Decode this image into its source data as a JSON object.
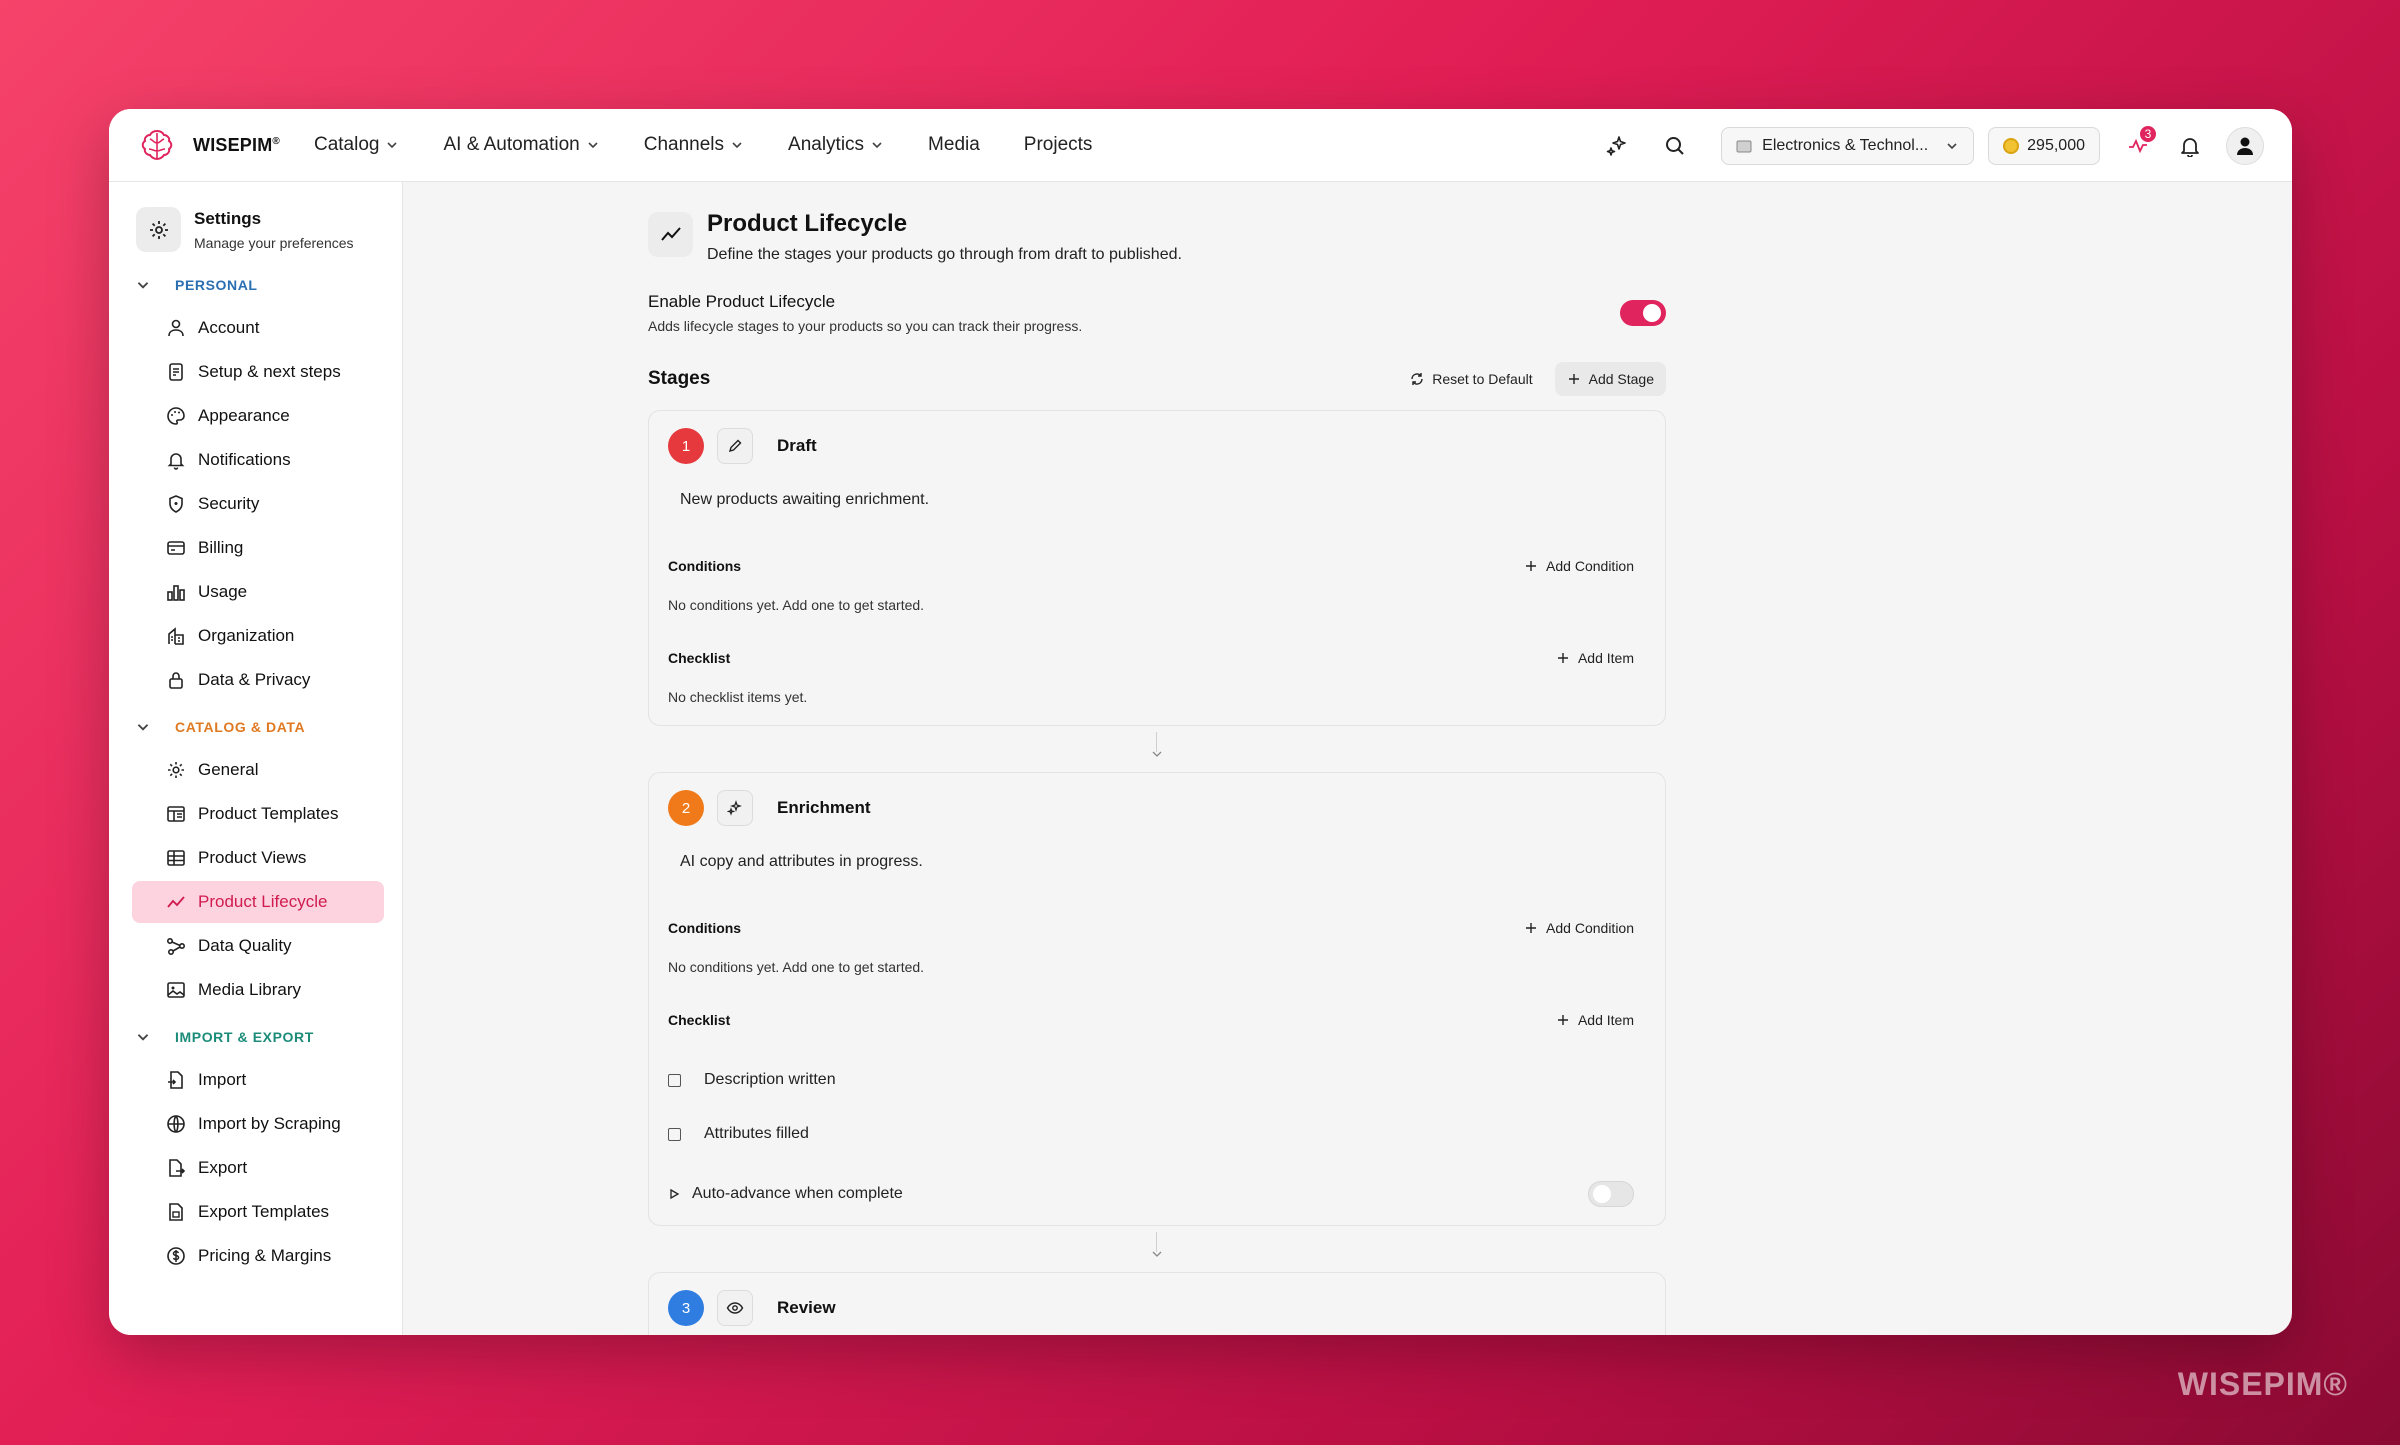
{
  "brand": {
    "name": "WISEPIM",
    "mark": "®",
    "watermark": "WISEPIM®"
  },
  "nav": [
    {
      "label": "Catalog",
      "dropdown": true
    },
    {
      "label": "AI & Automation",
      "dropdown": true
    },
    {
      "label": "Channels",
      "dropdown": true
    },
    {
      "label": "Analytics",
      "dropdown": true
    },
    {
      "label": "Media",
      "dropdown": false
    },
    {
      "label": "Projects",
      "dropdown": false
    }
  ],
  "topbar": {
    "workspace": "Electronics & Technol...",
    "credits": "295,000",
    "activity_badge": "3"
  },
  "sidebar": {
    "title": "Settings",
    "subtitle": "Manage your preferences",
    "sections": [
      {
        "label": "PERSONAL",
        "items": [
          "Account",
          "Setup & next steps",
          "Appearance",
          "Notifications",
          "Security",
          "Billing",
          "Usage",
          "Organization",
          "Data & Privacy"
        ]
      },
      {
        "label": "CATALOG & DATA",
        "items": [
          "General",
          "Product Templates",
          "Product Views",
          "Product Lifecycle",
          "Data Quality",
          "Media Library"
        ]
      },
      {
        "label": "IMPORT & EXPORT",
        "items": [
          "Import",
          "Import by Scraping",
          "Export",
          "Export Templates",
          "Pricing & Margins"
        ]
      }
    ],
    "active": "Product Lifecycle"
  },
  "page": {
    "title": "Product Lifecycle",
    "subtitle": "Define the stages your products go through from draft to published.",
    "enable_title": "Enable Product Lifecycle",
    "enable_sub": "Adds lifecycle stages to your products so you can track their progress.",
    "enable_on": true,
    "stages_title": "Stages",
    "reset_label": "Reset to Default",
    "add_stage_label": "Add Stage"
  },
  "stages": [
    {
      "num": "1",
      "name": "Draft",
      "color": "#e5393d",
      "icon": "pencil-icon",
      "desc": "New products awaiting enrichment.",
      "conditions_label": "Conditions",
      "add_condition": "Add Condition",
      "conditions_empty": "No conditions yet. Add one to get started.",
      "checklist_label": "Checklist",
      "add_item": "Add Item",
      "checklist_empty": "No checklist items yet."
    },
    {
      "num": "2",
      "name": "Enrichment",
      "color": "#f07a1a",
      "icon": "sparkles-icon",
      "desc": "AI copy and attributes in progress.",
      "conditions_label": "Conditions",
      "add_condition": "Add Condition",
      "conditions_empty": "No conditions yet. Add one to get started.",
      "checklist_label": "Checklist",
      "add_item": "Add Item",
      "checklist": [
        "Description written",
        "Attributes filled"
      ],
      "auto_advance": "Auto-advance when complete"
    },
    {
      "num": "3",
      "name": "Review",
      "color": "#2f7de1",
      "icon": "eye-icon"
    }
  ]
}
